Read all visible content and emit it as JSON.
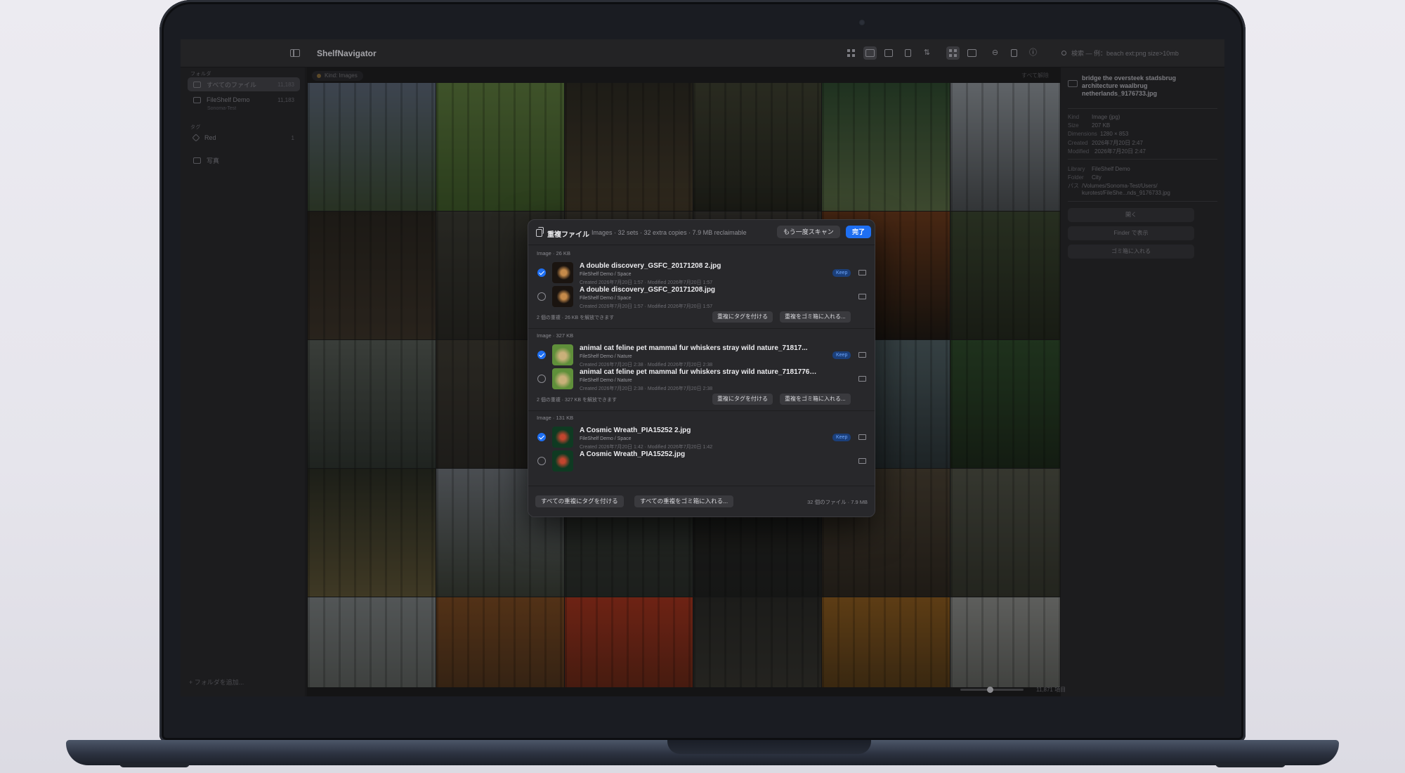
{
  "app": {
    "title": "ShelfNavigator",
    "search_placeholder": "検索 — 例：beach ext:png size>10mb"
  },
  "sidebar": {
    "section_folders": "フォルダ",
    "items": [
      {
        "label": "すべてのファイル",
        "count": "11,183"
      },
      {
        "label": "FileShelf Demo",
        "sub": "Sonoma-Test",
        "count": "11,183"
      }
    ],
    "section_tags": "タグ",
    "tags": [
      {
        "label": "Red",
        "count": "1"
      },
      {
        "label": "写真",
        "count": ""
      }
    ],
    "add_folder": "+ フォルダを追加..."
  },
  "filter": {
    "chip": "Kind: Images",
    "clear_all": "すべて解除"
  },
  "grid": {
    "photos": [
      {
        "c1": "#5b6676",
        "c2": "#3b4a34"
      },
      {
        "c1": "#5d7a3e",
        "c2": "#3f5a2a"
      },
      {
        "c1": "#2c2a22",
        "c2": "#453b2b"
      },
      {
        "c1": "#3d3f30",
        "c2": "#26271f"
      },
      {
        "c1": "#2f4a30",
        "c2": "#5a6b45"
      },
      {
        "c1": "#8d9399",
        "c2": "#4b4f52"
      },
      {
        "c1": "#2a2620",
        "c2": "#3c342a"
      },
      {
        "c1": "#3a3a33",
        "c2": "#2a2924"
      },
      {
        "c1": "#403b33",
        "c2": "#2d2a25"
      },
      {
        "c1": "#3c3a35",
        "c2": "#2b2925"
      },
      {
        "c1": "#6b3a1c",
        "c2": "#201a15"
      },
      {
        "c1": "#3a4530",
        "c2": "#24291e"
      },
      {
        "c1": "#555b55",
        "c2": "#2f3530"
      },
      {
        "c1": "#3d3a32",
        "c2": "#2c2a26"
      },
      {
        "c1": "#2d3430",
        "c2": "#1e2220"
      },
      {
        "c1": "#2f3730",
        "c2": "#1f241f"
      },
      {
        "c1": "#4f5f63",
        "c2": "#2c3538"
      },
      {
        "c1": "#2e4a2b",
        "c2": "#1d2a1b"
      },
      {
        "c1": "#2a2d24",
        "c2": "#5d5436"
      },
      {
        "c1": "#6d7278",
        "c2": "#3a3f36"
      },
      {
        "c1": "#3b3f3a",
        "c2": "#2a2e2a"
      },
      {
        "c1": "#2a2b27",
        "c2": "#202120"
      },
      {
        "c1": "#4a4134",
        "c2": "#2e2820"
      },
      {
        "c1": "#4f5146",
        "c2": "#34362d"
      },
      {
        "c1": "#7a7f80",
        "c2": "#50534f"
      },
      {
        "c1": "#7a4a22",
        "c2": "#3c2a1b"
      },
      {
        "c1": "#a2341e",
        "c2": "#4f2416"
      },
      {
        "c1": "#2a2a27",
        "c2": "#3a3933"
      },
      {
        "c1": "#8a5a1f",
        "c2": "#3e2e17"
      },
      {
        "c1": "#8a8b88",
        "c2": "#4f514d"
      }
    ]
  },
  "inspector": {
    "title": "bridge the oversteek stadsbrug architecture waalbrug netherlands_9176733.jpg",
    "meta": [
      {
        "k": "Kind",
        "v": "Image (jpg)"
      },
      {
        "k": "Size",
        "v": "207 KB"
      },
      {
        "k": "Dimensions",
        "v": "1280 × 853"
      },
      {
        "k": "Created",
        "v": "2026年7月20日 2:47"
      },
      {
        "k": "Modified",
        "v": "2026年7月20日 2:47"
      }
    ],
    "meta2": [
      {
        "k": "Library",
        "v": "FileShelf Demo"
      },
      {
        "k": "Folder",
        "v": "City"
      },
      {
        "k": "パス",
        "v": "/Volumes/Sonoma-Test/Users/ kurotest/FileShe...nds_9176733.jpg"
      }
    ],
    "buttons": [
      "開く",
      "Finder で表示",
      "ゴミ箱に入れる"
    ],
    "status_count": "11,871 項目"
  },
  "dialog": {
    "title": "重複ファイル",
    "summary": "Images · 32 sets · 32 extra copies · 7.9 MB reclaimable",
    "rescan_label": "もう一度スキャン",
    "done_label": "完了",
    "keep_label": "Keep",
    "groups": [
      {
        "header": "Image · 26 KB",
        "files": [
          {
            "name": "A double discovery_GSFC_20171208 2.jpg",
            "lib": "FileShelf Demo / Space",
            "dates": "Created 2026年7月20日 1:57 · Modified 2026年7月20日 1:57",
            "keep": true,
            "thumb_c1": "#1a1410",
            "thumb_c2": "#c58a4a"
          },
          {
            "name": "A double discovery_GSFC_20171208.jpg",
            "lib": "FileShelf Demo / Space",
            "dates": "Created 2026年7月20日 1:57 · Modified 2026年7月20日 1:57",
            "keep": false,
            "thumb_c1": "#1a1410",
            "thumb_c2": "#c58a4a"
          }
        ],
        "footer": "2 個の重複 · 26 KB を解放できます"
      },
      {
        "header": "Image · 327 KB",
        "files": [
          {
            "name": "animal cat feline pet mammal fur whiskers stray wild nature_71817...",
            "lib": "FileShelf Demo / Nature",
            "dates": "Created 2026年7月20日 2:38 · Modified 2026年7月20日 2:38",
            "keep": true,
            "thumb_c1": "#5f8f3a",
            "thumb_c2": "#c9b07a"
          },
          {
            "name": "animal cat feline pet mammal fur whiskers stray wild nature_7181776.jpg",
            "lib": "FileShelf Demo / Nature",
            "dates": "Created 2026年7月20日 2:38 · Modified 2026年7月20日 2:38",
            "keep": false,
            "thumb_c1": "#5f8f3a",
            "thumb_c2": "#c9b07a"
          }
        ],
        "footer": "2 個の重複 · 327 KB を解放できます"
      },
      {
        "header": "Image · 131 KB",
        "files": [
          {
            "name": "A Cosmic Wreath_PIA15252 2.jpg",
            "lib": "FileShelf Demo / Space",
            "dates": "Created 2026年7月20日 1:42 · Modified 2026年7月20日 1:42",
            "keep": true,
            "thumb_c1": "#0f3a22",
            "thumb_c2": "#c2452e"
          },
          {
            "name": "A Cosmic Wreath_PIA15252.jpg",
            "lib": "FileShelf Demo / Space",
            "dates": "",
            "keep": false,
            "thumb_c1": "#0f3a22",
            "thumb_c2": "#c2452e"
          }
        ],
        "footer": ""
      }
    ],
    "tag_dupes_label": "重複にタグを付ける",
    "trash_dupes_label": "重複をゴミ箱に入れる...",
    "footer_tag_all": "すべての重複にタグを付ける",
    "footer_trash_all": "すべての重複をゴミ箱に入れる...",
    "footer_total": "32 個のファイル · 7.9 MB"
  }
}
